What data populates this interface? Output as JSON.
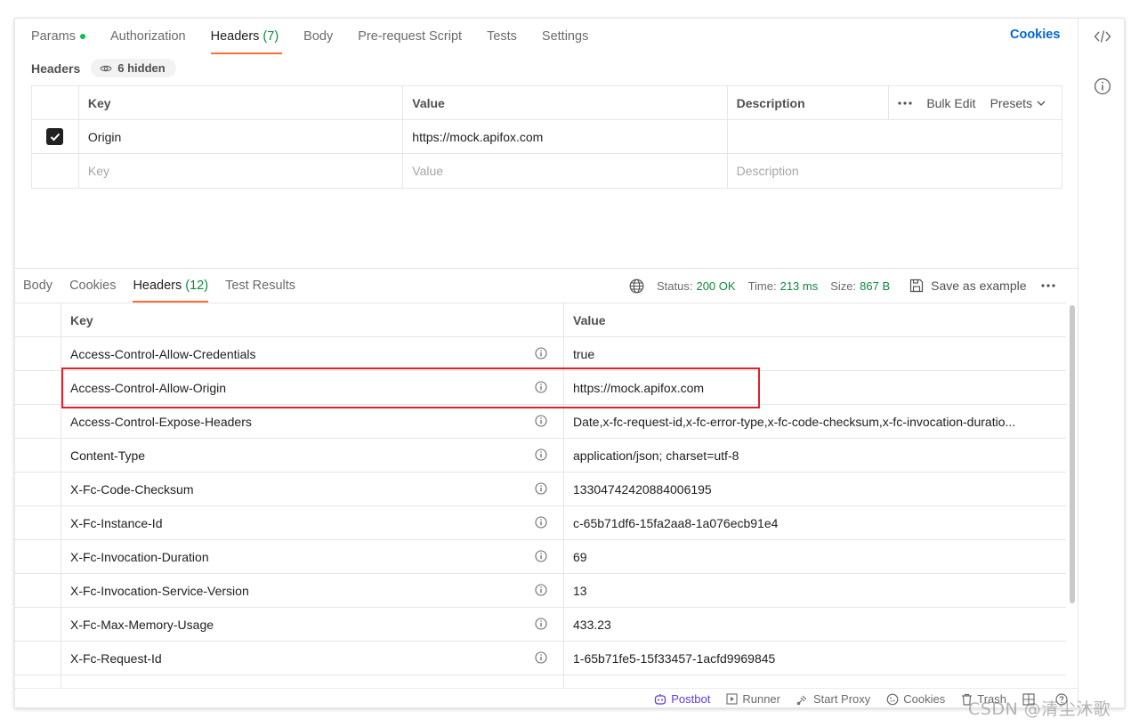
{
  "request_tabs": {
    "params": "Params",
    "authorization": "Authorization",
    "headers": "Headers",
    "headers_count": "(7)",
    "body": "Body",
    "pre_request": "Pre-request Script",
    "tests": "Tests",
    "settings": "Settings",
    "cookies": "Cookies"
  },
  "request_headers": {
    "label": "Headers",
    "hidden": "6 hidden",
    "col_key": "Key",
    "col_value": "Value",
    "col_description": "Description",
    "bulk_edit": "Bulk Edit",
    "presets": "Presets",
    "row": {
      "key": "Origin",
      "value": "https://mock.apifox.com",
      "checked": true
    },
    "placeholder_key": "Key",
    "placeholder_value": "Value",
    "placeholder_description": "Description"
  },
  "response_tabs": {
    "body": "Body",
    "cookies": "Cookies",
    "headers": "Headers",
    "headers_count": "(12)",
    "test_results": "Test Results"
  },
  "response_meta": {
    "status_label": "Status:",
    "status_value": "200 OK",
    "time_label": "Time:",
    "time_value": "213 ms",
    "size_label": "Size:",
    "size_value": "867 B",
    "save_example": "Save as example"
  },
  "response_headers": {
    "col_key": "Key",
    "col_value": "Value",
    "rows": [
      {
        "key": "Access-Control-Allow-Credentials",
        "value": "true"
      },
      {
        "key": "Access-Control-Allow-Origin",
        "value": "https://mock.apifox.com"
      },
      {
        "key": "Access-Control-Expose-Headers",
        "value": "Date,x-fc-request-id,x-fc-error-type,x-fc-code-checksum,x-fc-invocation-duratio..."
      },
      {
        "key": "Content-Type",
        "value": "application/json; charset=utf-8"
      },
      {
        "key": "X-Fc-Code-Checksum",
        "value": "13304742420884006195"
      },
      {
        "key": "X-Fc-Instance-Id",
        "value": "c-65b71df6-15fa2aa8-1a076ecb91e4"
      },
      {
        "key": "X-Fc-Invocation-Duration",
        "value": "69"
      },
      {
        "key": "X-Fc-Invocation-Service-Version",
        "value": "13"
      },
      {
        "key": "X-Fc-Max-Memory-Usage",
        "value": "433.23"
      },
      {
        "key": "X-Fc-Request-Id",
        "value": "1-65b71fe5-15f33457-1acfd9969845"
      }
    ]
  },
  "footer": {
    "postbot": "Postbot",
    "runner": "Runner",
    "start_proxy": "Start Proxy",
    "cookies": "Cookies",
    "trash": "Trash"
  },
  "watermark": "CSDN @清尘沐歌",
  "colors": {
    "accent": "#ff6c37",
    "link": "#0265d2",
    "status_green": "#0b8a3d",
    "highlight_red": "#e0202a"
  }
}
